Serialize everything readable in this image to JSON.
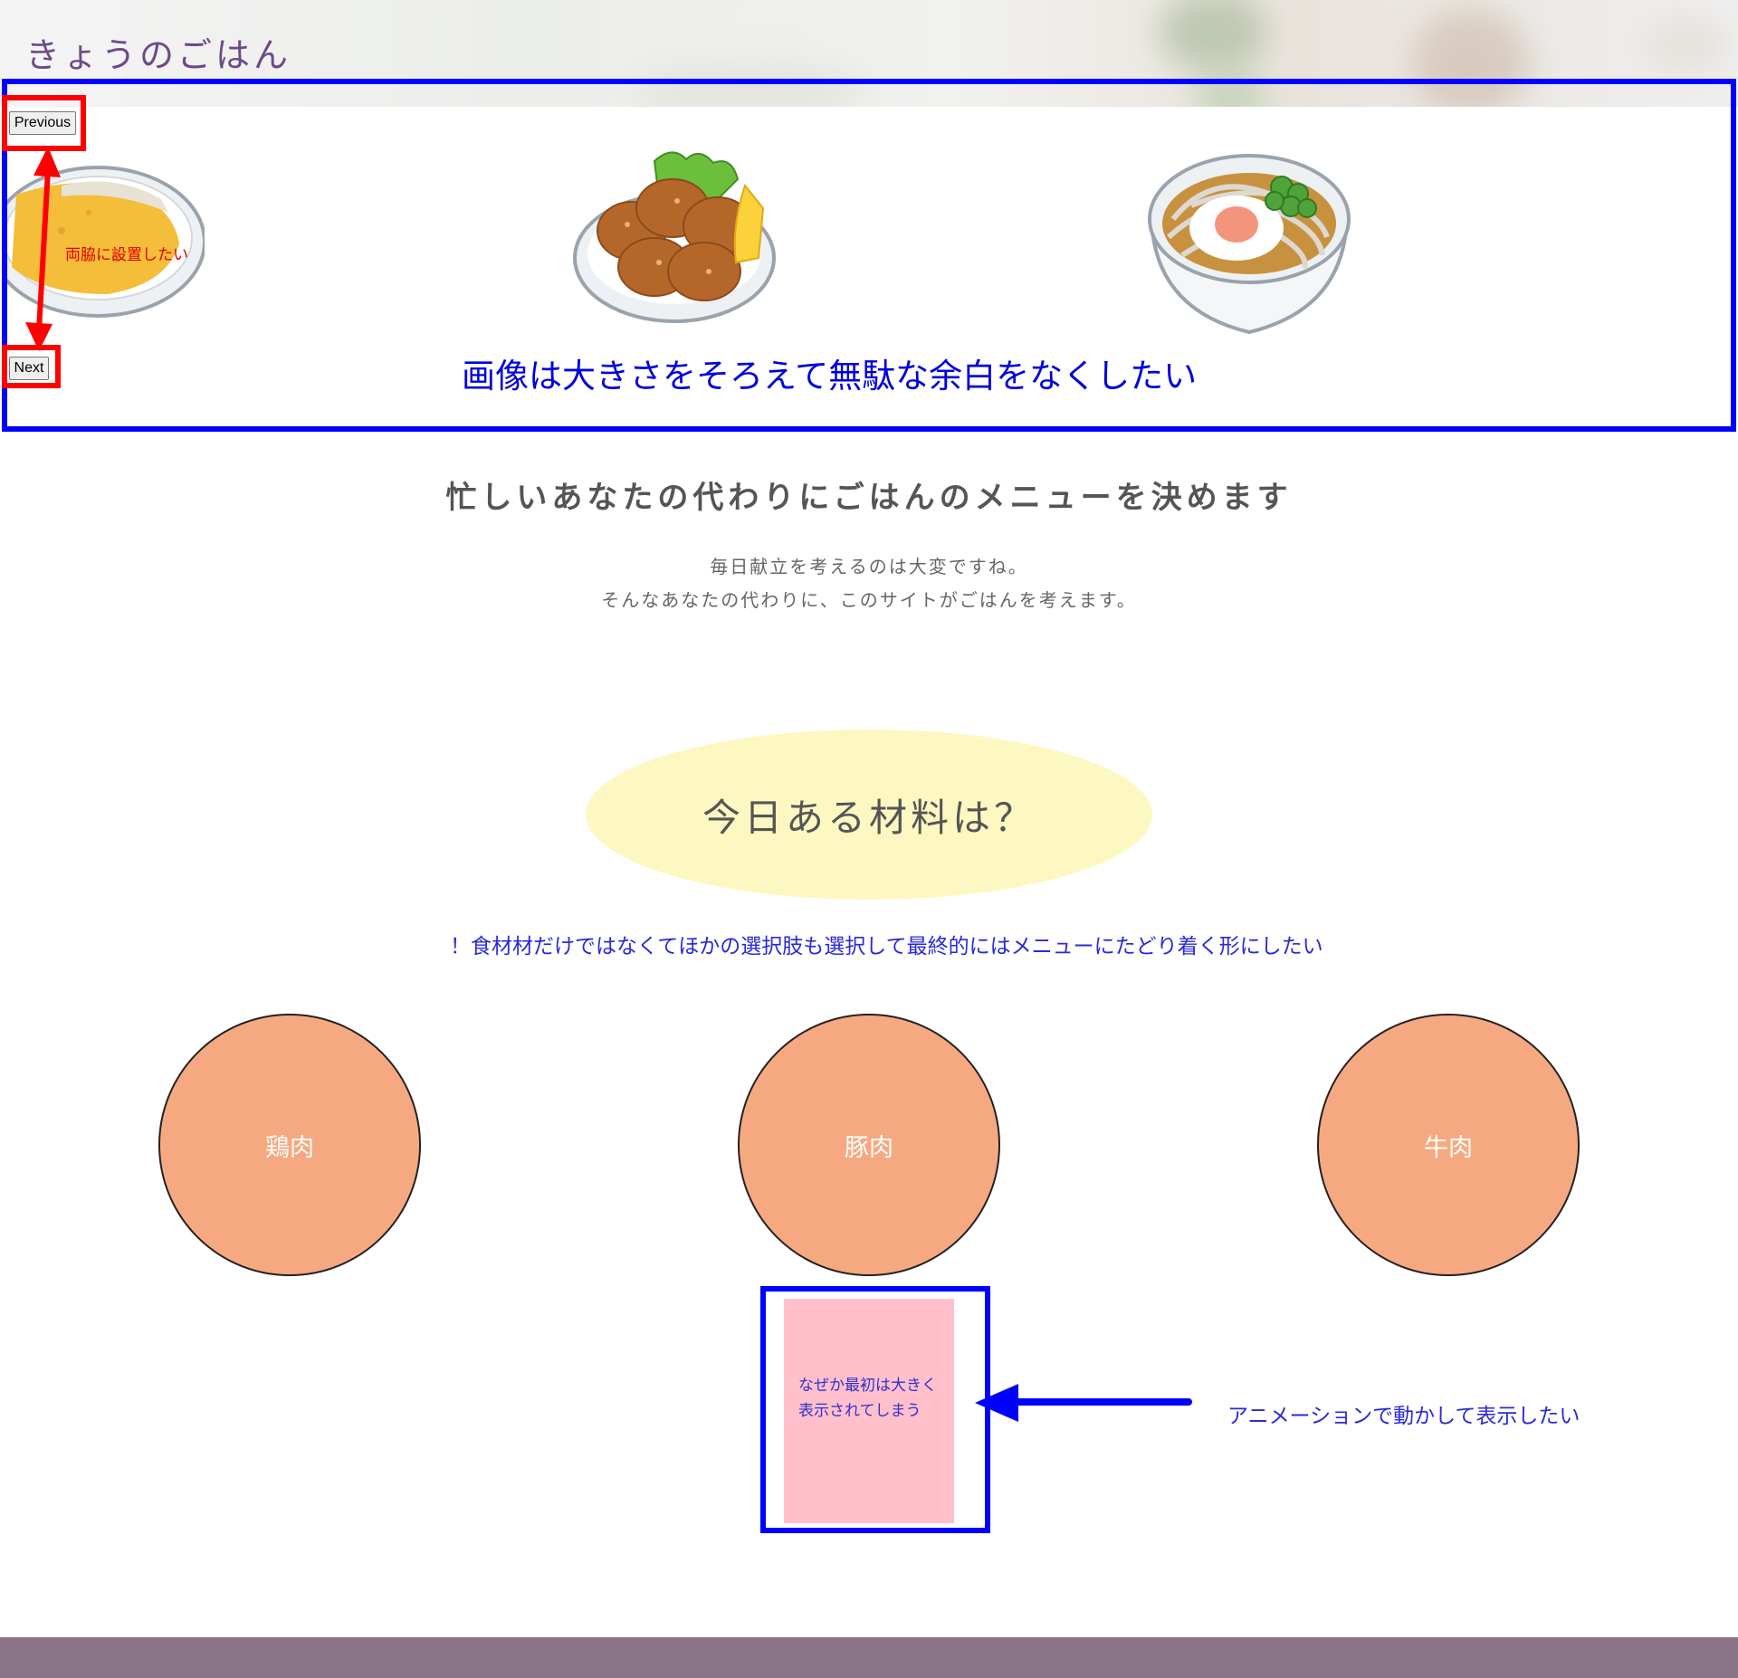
{
  "site": {
    "title": "きょうのごはん"
  },
  "slider": {
    "prev_label": "Previous",
    "next_label": "Next",
    "images": [
      "curry-rice-image",
      "karaage-image",
      "udon-egg-image"
    ],
    "note_sides": "両脇に設置したい",
    "note_images": "画像は大きさをそろえて無駄な余白をなくしたい"
  },
  "intro": {
    "lead": "忙しいあなたの代わりにごはんのメニューを決めます",
    "desc_line1": "毎日献立を考えるのは大変ですね。",
    "desc_line2": "そんなあなたの代わりに、このサイトがごはんを考えます。"
  },
  "question": {
    "title": "今日ある材料は？",
    "note": "！食材材だけではなくてほかの選択肢も選択して最終的にはメニューにたどり着く形にしたい"
  },
  "choices": [
    "鶏肉",
    "豚肉",
    "牛肉"
  ],
  "card": {
    "text_line1": "なぜか最初は大きく",
    "text_line2": "表示されてしまう",
    "note": "アニメーションで動かして表示したい"
  },
  "colors": {
    "title": "#6d4a86",
    "annotation_blue": "#0000ff",
    "annotation_red": "#ff0000",
    "choice": "#f6a980",
    "question_bg": "#fdf8c2",
    "card": "#ffc0cb",
    "footer": "#8a7384"
  }
}
